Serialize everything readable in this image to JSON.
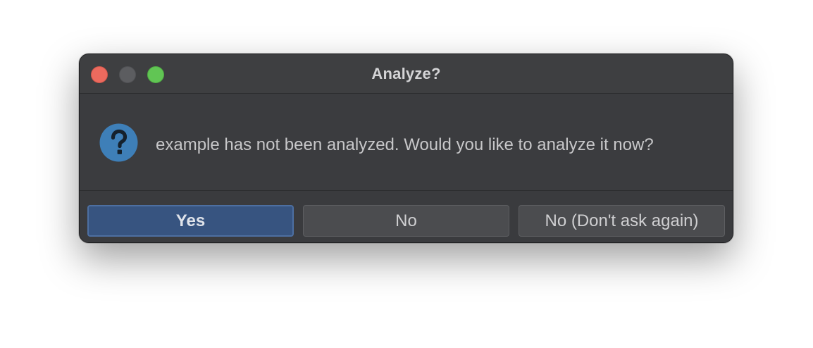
{
  "window": {
    "title": "Analyze?"
  },
  "dialog": {
    "icon": "question-icon",
    "message": "example has not been analyzed. Would you like to analyze it now?"
  },
  "buttons": {
    "yes_label": "Yes",
    "no_label": "No",
    "no_ask_label": "No (Don't ask again)"
  },
  "colors": {
    "accent": "#375480",
    "icon_blue": "#3e7fb8",
    "close": "#ec6a5e",
    "zoom": "#61c554"
  }
}
